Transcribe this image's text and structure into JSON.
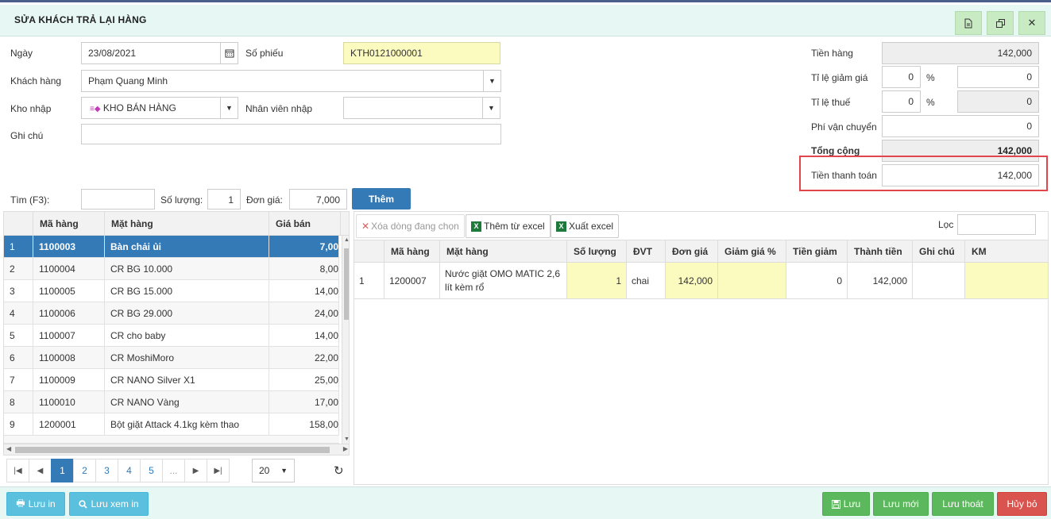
{
  "window": {
    "title": "SỬA KHÁCH TRẢ LẠI HÀNG"
  },
  "form": {
    "date_label": "Ngày",
    "date_value": "23/08/2021",
    "voucher_label": "Số phiếu",
    "voucher_value": "KTH0121000001",
    "customer_label": "Khách hàng",
    "customer_value": "Phạm Quang Minh",
    "warehouse_label": "Kho nhập",
    "warehouse_value": "KHO BÁN HÀNG",
    "staff_label": "Nhân viên nhập",
    "staff_value": "",
    "note_label": "Ghi chú",
    "note_value": ""
  },
  "summary": {
    "goods_label": "Tiền hàng",
    "goods_value": "142,000",
    "discount_label": "Tỉ lệ giảm giá",
    "discount_pct": "0",
    "pct_sign": "%",
    "discount_value": "0",
    "tax_label": "Tỉ lệ thuế",
    "tax_pct": "0",
    "tax_sign": "%",
    "tax_value": "0",
    "shipping_label": "Phí vận chuyển",
    "shipping_value": "0",
    "total_label": "Tổng cộng",
    "total_value": "142,000",
    "payment_label": "Tiền thanh toán",
    "payment_value": "142,000"
  },
  "search": {
    "find_label": "Tìm (F3):",
    "find_value": "",
    "qty_label": "Số lượng:",
    "qty_value": "1",
    "price_label": "Đơn giá:",
    "price_value": "7,000",
    "add_button": "Thêm"
  },
  "product_grid": {
    "headers": [
      "Mã hàng",
      "Mặt hàng",
      "Giá bán"
    ],
    "rows": [
      {
        "idx": "1",
        "code": "1100003",
        "name": "Bàn chải ủi",
        "price": "7,00"
      },
      {
        "idx": "2",
        "code": "1100004",
        "name": "CR BG 10.000",
        "price": "8,00"
      },
      {
        "idx": "3",
        "code": "1100005",
        "name": "CR BG 15.000",
        "price": "14,00"
      },
      {
        "idx": "4",
        "code": "1100006",
        "name": "CR BG 29.000",
        "price": "24,00"
      },
      {
        "idx": "5",
        "code": "1100007",
        "name": "CR cho baby",
        "price": "14,00"
      },
      {
        "idx": "6",
        "code": "1100008",
        "name": "CR MoshiMoro",
        "price": "22,00"
      },
      {
        "idx": "7",
        "code": "1100009",
        "name": "CR NANO Silver X1",
        "price": "25,00"
      },
      {
        "idx": "8",
        "code": "1100010",
        "name": "CR NANO Vàng",
        "price": "17,00"
      },
      {
        "idx": "9",
        "code": "1200001",
        "name": "Bột giặt Attack 4.1kg kèm thao",
        "price": "158,00"
      }
    ]
  },
  "pager": {
    "pages": [
      "1",
      "2",
      "3",
      "4",
      "5",
      "..."
    ],
    "page_size": "20"
  },
  "detail": {
    "delete_button": "Xóa dòng đang chọn",
    "import_button": "Thêm từ excel",
    "export_button": "Xuất excel",
    "filter_label": "Lọc",
    "filter_value": "",
    "headers": [
      "Mã hàng",
      "Mặt hàng",
      "Số lượng",
      "ĐVT",
      "Đơn giá",
      "Giảm giá %",
      "Tiền giảm",
      "Thành tiền",
      "Ghi chú",
      "KM"
    ],
    "row": {
      "idx": "1",
      "code": "1200007",
      "name": "Nước giặt OMO MATIC 2,6 lít kèm rổ",
      "qty": "1",
      "unit": "chai",
      "price": "142,000",
      "disc_pct": "",
      "disc_amt": "0",
      "amount": "142,000",
      "note": "",
      "km": ""
    }
  },
  "footer": {
    "print_button": "Lưu in",
    "preview_button": "Lưu xem in",
    "save_button": "Lưu",
    "save_new_button": "Lưu mới",
    "save_exit_button": "Lưu thoát",
    "cancel_button": "Hủy bỏ"
  }
}
